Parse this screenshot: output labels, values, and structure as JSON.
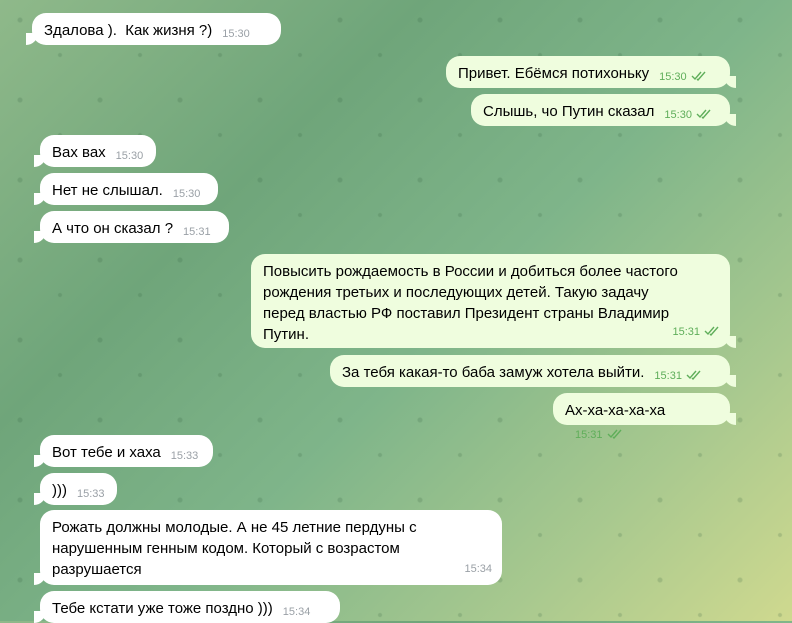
{
  "messages": [
    {
      "text": "Здалова ).  Как жизня ?)",
      "time": "15:30"
    },
    {
      "text": "Привет. Ебёмся потихоньку",
      "time": "15:30"
    },
    {
      "text": "Слышь, чо Путин сказал",
      "time": "15:30"
    },
    {
      "text": "Вах вах",
      "time": "15:30"
    },
    {
      "text": "Нет не слышал.",
      "time": "15:30"
    },
    {
      "text": "А что он сказал ?",
      "time": "15:31"
    },
    {
      "text": "Повысить рождаемость в России и добиться более частого\nрождения третьих и последующих детей. Такую задачу\nперед властью РФ поставил Президент страны Владимир\nПутин.",
      "time": "15:31"
    },
    {
      "text": "За тебя какая-то баба замуж хотела выйти.",
      "time": "15:31"
    },
    {
      "text": "Ах-ха-ха-ха-ха",
      "time": "15:31"
    },
    {
      "text": "Вот тебе и хаха",
      "time": "15:33"
    },
    {
      "text": ")))",
      "time": "15:33"
    },
    {
      "text": "Рожать должны молодые. А не 45 летние пердуны с\nнарушенным генным кодом. Который с возрастом\nразрушается",
      "time": "15:34"
    },
    {
      "text": "Тебе кстати уже тоже поздно )))",
      "time": "15:34"
    }
  ]
}
